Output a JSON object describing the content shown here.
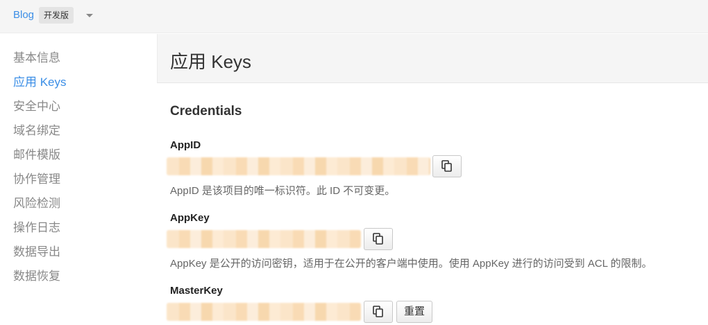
{
  "topbar": {
    "app_name": "Blog",
    "env_badge": "开发版"
  },
  "sidebar": {
    "items": [
      {
        "label": "基本信息"
      },
      {
        "label": "应用 Keys",
        "active": true
      },
      {
        "label": "安全中心"
      },
      {
        "label": "域名绑定"
      },
      {
        "label": "邮件模版"
      },
      {
        "label": "协作管理"
      },
      {
        "label": "风险检测"
      },
      {
        "label": "操作日志"
      },
      {
        "label": "数据导出"
      },
      {
        "label": "数据恢复"
      }
    ]
  },
  "main": {
    "title": "应用 Keys",
    "section_title": "Credentials",
    "fields": [
      {
        "label": "AppID",
        "help": "AppID 是该项目的唯一标识符。此 ID 不可变更。"
      },
      {
        "label": "AppKey",
        "help": "AppKey 是公开的访问密钥，适用于在公开的客户端中使用。使用 AppKey 进行的访问受到 ACL 的限制。"
      },
      {
        "label": "MasterKey",
        "reset_label": "重置"
      }
    ]
  },
  "icons": [
    "copy-icon",
    "chevron-down-icon"
  ],
  "colors": {
    "accent": "#3b8ee6"
  }
}
